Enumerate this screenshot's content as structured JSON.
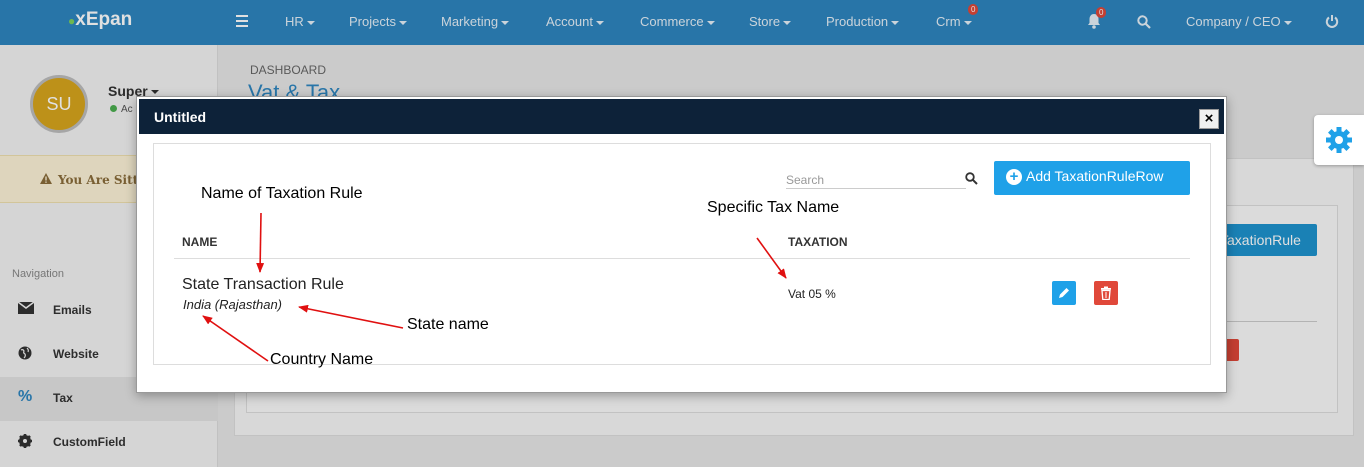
{
  "app": {
    "logo": "xEpan"
  },
  "topnav": {
    "items": [
      {
        "label": "HR"
      },
      {
        "label": "Projects"
      },
      {
        "label": "Marketing"
      },
      {
        "label": "Account"
      },
      {
        "label": "Commerce"
      },
      {
        "label": "Store"
      },
      {
        "label": "Production"
      },
      {
        "label": "Crm",
        "badge": "0"
      }
    ],
    "notifications_badge": "0",
    "company": "Company / CEO"
  },
  "sidebar": {
    "avatar_initials": "SU",
    "user_name": "Super",
    "user_status": "Ac",
    "warning_text": "You Are Sitti",
    "nav_heading": "Navigation",
    "items": [
      {
        "label": "Emails",
        "icon": "envelope-icon"
      },
      {
        "label": "Website",
        "icon": "globe-icon"
      },
      {
        "label": "Tax",
        "icon": "percent-icon",
        "active": true
      },
      {
        "label": "CustomField",
        "icon": "gear-icon"
      }
    ]
  },
  "page": {
    "breadcrumb": "DASHBOARD",
    "title": "Vat & Tax",
    "background_button": "TaxationRule"
  },
  "modal": {
    "title": "Untitled",
    "close_label": "×",
    "search_placeholder": "Search",
    "add_button": "Add TaxationRuleRow",
    "columns": {
      "name": "NAME",
      "taxation": "TAXATION"
    },
    "rows": [
      {
        "name": "State Transaction Rule",
        "location": "India (Rajasthan)",
        "taxation": "Vat 05 %"
      }
    ]
  },
  "annotations": {
    "rule_name": "Name of Taxation Rule",
    "tax_name": "Specific Tax Name",
    "state_name": "State name",
    "country_name": "Country Name",
    "arrow_color": "#e01010"
  },
  "colors": {
    "topbar": "#2e86c0",
    "modal_header": "#0d2239",
    "primary_button": "#1fa1e8",
    "danger_button": "#e0483a"
  }
}
